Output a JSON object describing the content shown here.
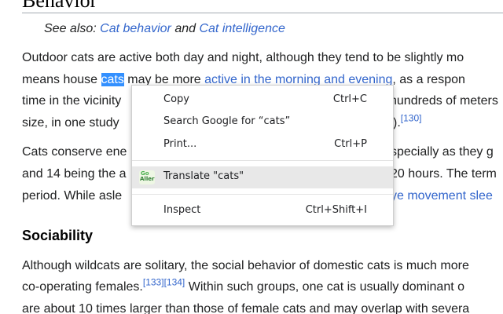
{
  "article": {
    "heading_top": "Behavior",
    "hatnote": {
      "prefix": "See also: ",
      "link1": "Cat behavior",
      "middle": " and ",
      "link2": "Cat intelligence"
    },
    "p1": {
      "l1": "Outdoor cats are active both day and night, although they tend to be slightly mo",
      "l2_a": "means house ",
      "l2_sel": "cats",
      "l2_b": " may be more ",
      "l2_link": "active in the morning and evening",
      "l2_c": ", as a respon",
      "l3_a": "time in the vicinity",
      "l3_b": "hundreds of meters",
      "l4_a": "size, in one study",
      "l4_b": ").",
      "l4_ref": "[130]"
    },
    "p2": {
      "l1_a": "Cats conserve ene",
      "l1_b": "specially as they g",
      "l2_a": "and 14 being the a",
      "l2_b": "20 hours. The term",
      "l3_a": "period. While asle",
      "l3_link": "ye movement slee"
    },
    "sociability": {
      "heading": "Sociability",
      "l1": "Although wildcats are solitary, the social behavior of domestic cats is much more",
      "l2_a": "co-operating females.",
      "l2_ref1": "[133]",
      "l2_ref2": "[134]",
      "l2_b": " Within such groups, one cat is usually dominant o",
      "l3": "are about 10 times larger than those of female cats and may overlap with severa"
    }
  },
  "context_menu": {
    "copy": {
      "label": "Copy",
      "shortcut": "Ctrl+C"
    },
    "search_google": {
      "label": "Search Google for “cats”"
    },
    "print": {
      "label": "Print...",
      "shortcut": "Ctrl+P"
    },
    "translate": {
      "label": "Translate \"cats\"",
      "icon_top": "Go",
      "icon_bottom": "Aller"
    },
    "inspect": {
      "label": "Inspect",
      "shortcut": "Ctrl+Shift+I"
    }
  },
  "colors": {
    "link": "#3366cc",
    "selection": "#3390ff",
    "menu_hover": "#e8e8e8"
  }
}
